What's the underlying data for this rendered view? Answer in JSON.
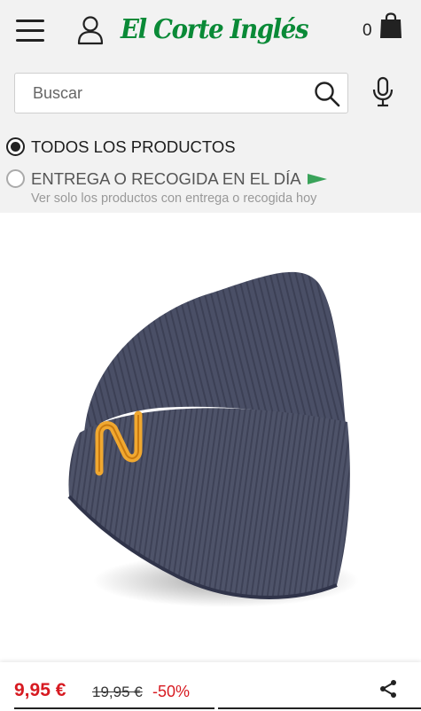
{
  "header": {
    "logo_text": "El Corte Inglés",
    "cart_count": "0",
    "icons": [
      "menu-icon",
      "user-icon",
      "shopping-bag-icon"
    ]
  },
  "search": {
    "placeholder": "Buscar",
    "icons": [
      "search-icon",
      "microphone-icon"
    ]
  },
  "filters": {
    "all_products": {
      "label": "TODOS LOS PRODUCTOS",
      "selected": true
    },
    "same_day": {
      "label": "ENTREGA O RECOGIDA EN EL DÍA",
      "sublabel": "Ver solo los productos con entrega o recogida hoy",
      "selected": false,
      "icon": "flag-icon"
    }
  },
  "product": {
    "image_icon": "beanie-hat-image",
    "price": "9,95 €",
    "old_price": "19,95 €",
    "discount": "-50%",
    "share_icon": "share-icon"
  },
  "colors": {
    "brand_green": "#0a8a37",
    "price_red": "#d71a21",
    "top_background": "#f2f2f2",
    "beanie": "#4a4f66",
    "logo_stitch": "#f0a830"
  }
}
